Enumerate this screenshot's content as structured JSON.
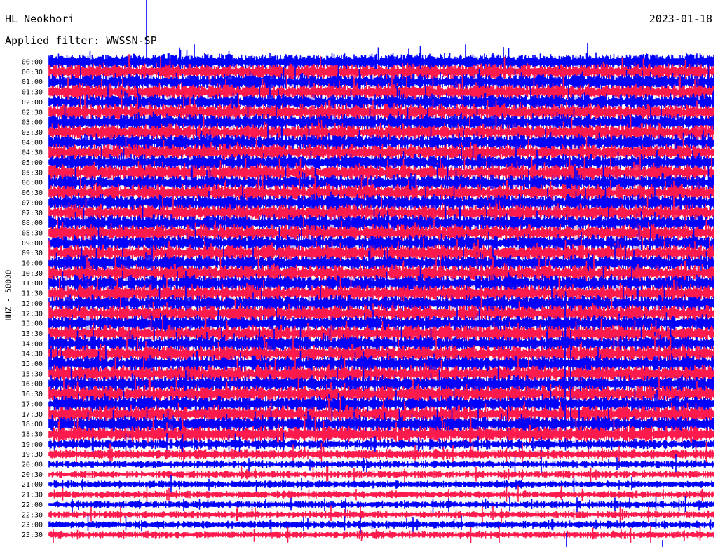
{
  "header": {
    "station": "HL Neokhori",
    "date": "2023-01-18",
    "filter": "Applied filter: WWSSN-SP"
  },
  "chart_data": {
    "type": "line",
    "subtype": "helicorder",
    "title": "HL Neokhori",
    "date": "2023-01-18",
    "filter": "Applied filter: WWSSN-SP",
    "ylabel": "HHZ - 50000",
    "row_labels": [
      "00:00",
      "00:30",
      "01:00",
      "01:30",
      "02:00",
      "02:30",
      "03:00",
      "03:30",
      "04:00",
      "04:30",
      "05:00",
      "05:30",
      "06:00",
      "06:30",
      "07:00",
      "07:30",
      "08:00",
      "08:30",
      "09:00",
      "09:30",
      "10:00",
      "10:30",
      "11:00",
      "11:30",
      "12:00",
      "12:30",
      "13:00",
      "13:30",
      "14:00",
      "14:30",
      "15:00",
      "15:30",
      "16:00",
      "16:30",
      "17:00",
      "17:30",
      "18:00",
      "18:30",
      "19:00",
      "19:30",
      "20:00",
      "20:30",
      "21:00",
      "21:30",
      "22:00",
      "22:30",
      "23:00",
      "23:30"
    ],
    "row_minutes": 30,
    "trace_colors": [
      "#0000ff",
      "#ff1a4d"
    ],
    "grid": false,
    "legend": "none"
  }
}
